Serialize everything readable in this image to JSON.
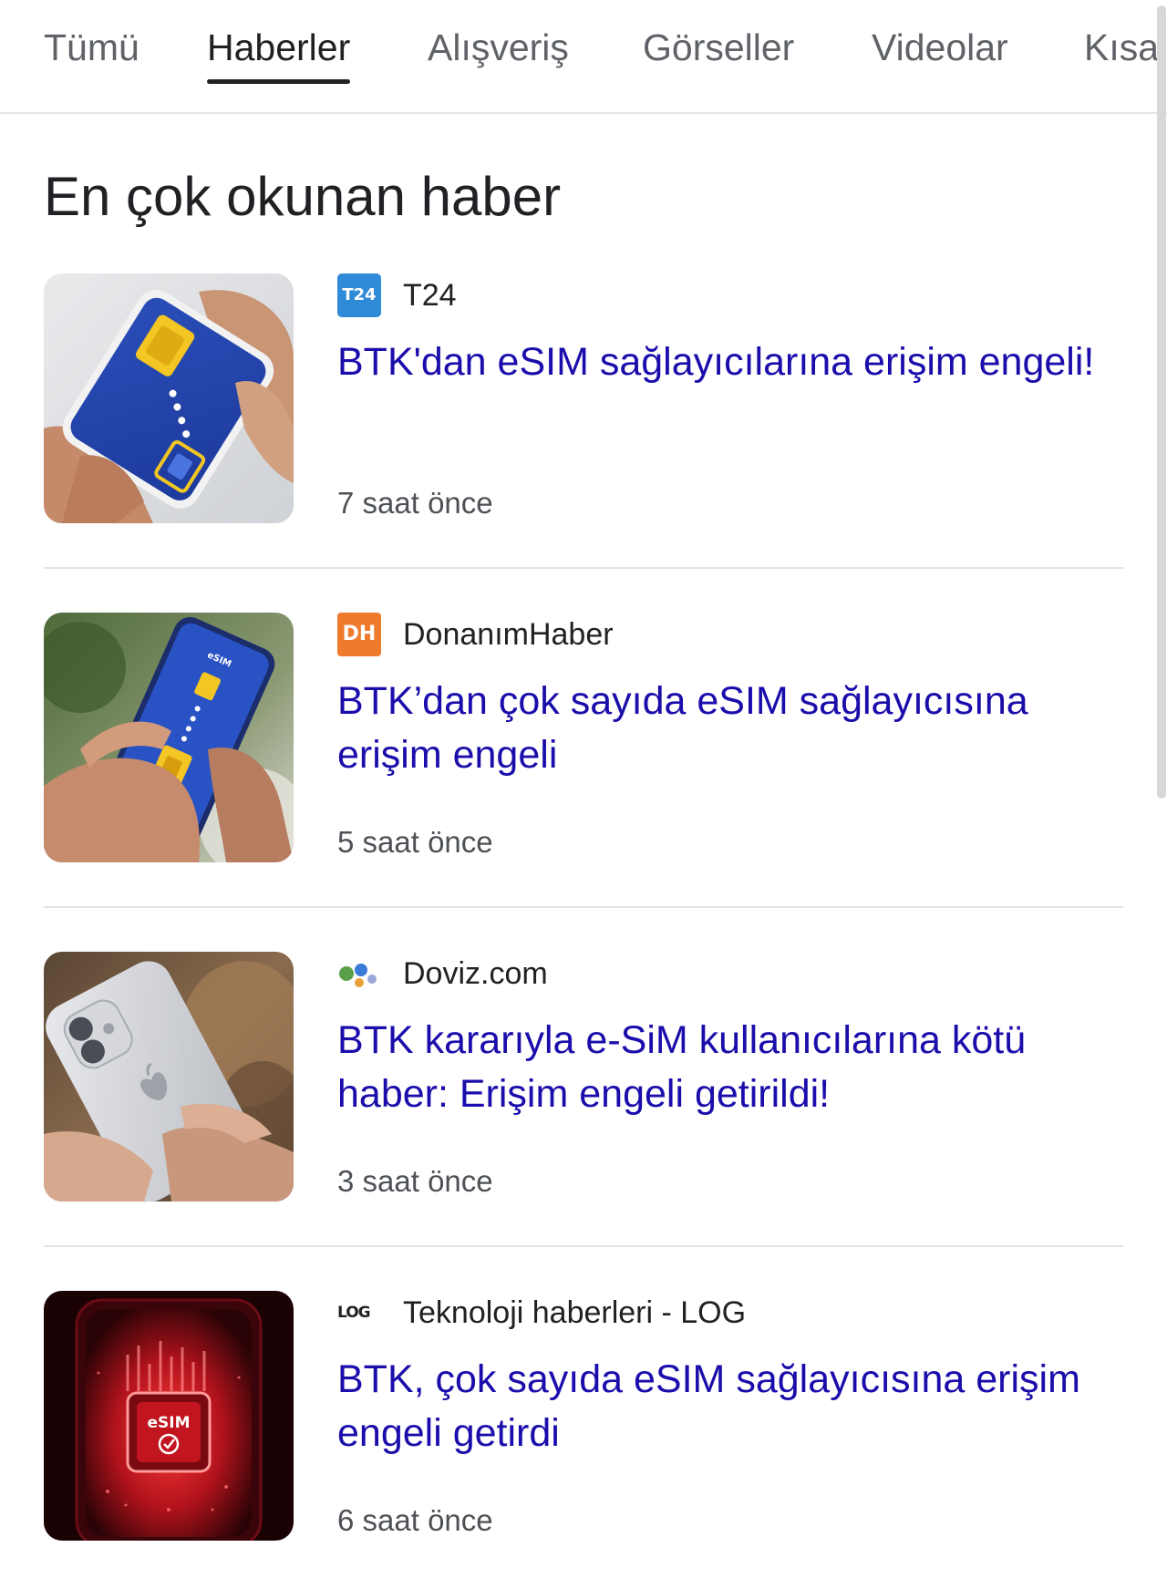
{
  "tabs": [
    {
      "label": "Tümü",
      "active": false
    },
    {
      "label": "Haberler",
      "active": true
    },
    {
      "label": "Alışveriş",
      "active": false
    },
    {
      "label": "Görseller",
      "active": false
    },
    {
      "label": "Videolar",
      "active": false
    },
    {
      "label": "Kısa",
      "active": false
    }
  ],
  "section": {
    "title": "En çok okunan haber"
  },
  "news": [
    {
      "source": "T24",
      "logo_text": "T24",
      "logo_icon": "t24-logo",
      "headline": "BTK'dan eSIM sağlayıcılarına erişim engeli!",
      "time": "7 saat önce",
      "image": "hands-holding-phone-esim-icon"
    },
    {
      "source": "DonanımHaber",
      "logo_text": "DH",
      "logo_icon": "donanimhaber-logo",
      "headline": "BTK’dan çok sayıda eSIM sağlayıcısına erişim engeli",
      "time": "5 saat önce",
      "image": "hand-holding-phone-esim-transfer"
    },
    {
      "source": "Doviz.com",
      "logo_icon": "doviz-logo",
      "headline": "BTK kararıyla e-SiM kullanıcılarına kötü haber: Erişim engeli getirildi!",
      "time": "3 saat önce",
      "image": "hands-holding-iphone"
    },
    {
      "source": "Teknoloji haberleri - LOG",
      "logo_text": "LOG",
      "logo_icon": "log-logo",
      "headline": "BTK, çok sayıda eSIM sağlayıcısına erişim engeli getirdi",
      "time": "6 saat önce",
      "image": "red-esim-chip-on-phone"
    }
  ],
  "thumb_labels": {
    "esim_chip": "eSIM",
    "phone_header": "eSIM"
  },
  "colors": {
    "headline": "#1a0dab",
    "t24": "#2f8ad8",
    "donanimhaber": "#f07a2c",
    "active_tab": "#202124"
  }
}
